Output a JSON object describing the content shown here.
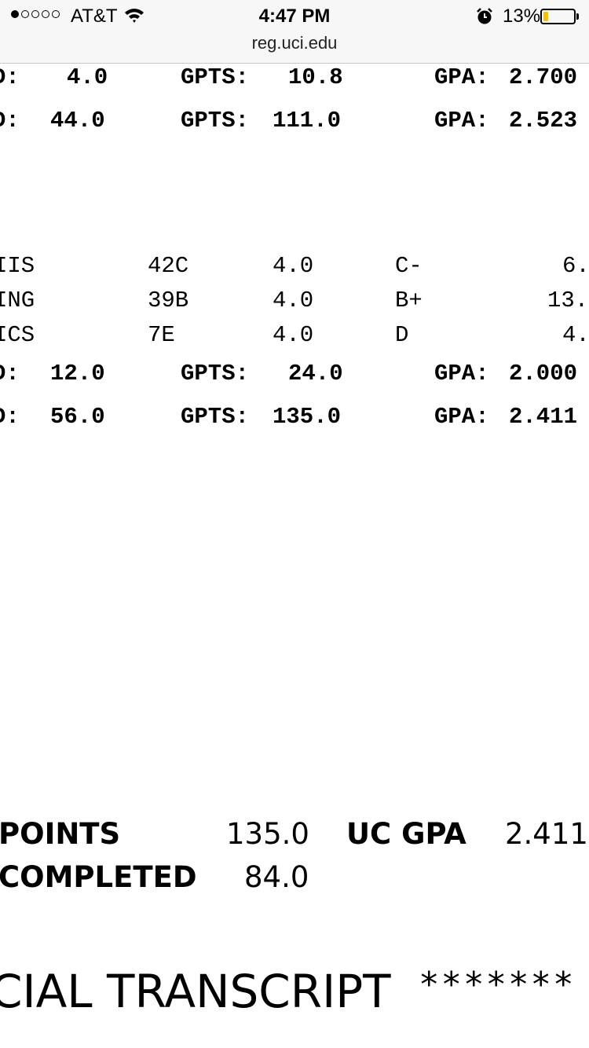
{
  "status_bar": {
    "carrier": "AT&T",
    "time": "4:47 PM",
    "url": "reg.uci.edu",
    "battery_percent_text": "13%",
    "battery_level": 0.13,
    "battery_color": "#f5c400",
    "signal_bars_filled": 1,
    "signal_bars_total": 5,
    "icons": [
      "wifi-icon",
      "alarm-icon",
      "battery-icon"
    ]
  },
  "term_summary_1": {
    "term": {
      "att_label": "D:",
      "att": "4.0",
      "gpts_label": "GPTS:",
      "gpts": "10.8",
      "gpa_label": "GPA:",
      "gpa": "2.700"
    },
    "cumulative": {
      "att_label": "D:",
      "att": "44.0",
      "gpts_label": "GPTS:",
      "gpts": "111.0",
      "gpa_label": "GPA:",
      "gpa": "2.523"
    }
  },
  "courses": [
    {
      "dept": "IIS",
      "num": "42C",
      "units": "4.0",
      "grade": "C-",
      "points": "6."
    },
    {
      "dept": "ING",
      "num": "39B",
      "units": "4.0",
      "grade": "B+",
      "points": "13."
    },
    {
      "dept": "ICS",
      "num": "7E",
      "units": "4.0",
      "grade": "D",
      "points": "4."
    }
  ],
  "term_summary_2": {
    "term": {
      "att_label": "D:",
      "att": "12.0",
      "gpts_label": "GPTS:",
      "gpts": "24.0",
      "gpa_label": "GPA:",
      "gpa": "2.000"
    },
    "cumulative": {
      "att_label": "D:",
      "att": "56.0",
      "gpts_label": "GPTS:",
      "gpts": "135.0",
      "gpa_label": "GPA:",
      "gpa": "2.411"
    }
  },
  "totals": {
    "points_label": "POINTS",
    "points": "135.0",
    "gpa_label": "UC GPA",
    "gpa": "2.411",
    "completed_label": "COMPLETED",
    "completed": "84.0"
  },
  "footer": {
    "text": "CIAL TRANSCRIPT",
    "stars": "*******"
  }
}
